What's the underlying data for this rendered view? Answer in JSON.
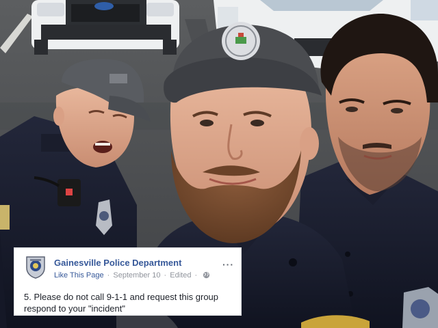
{
  "post": {
    "page_name": "Gainesville Police Department",
    "like_label": "Like This Page",
    "separator": "·",
    "date": "September 10",
    "edited_label": "Edited",
    "more_label": "···",
    "body_text": "5. Please do not call 9-1-1 and request this group respond to your \"incident\""
  },
  "icons": {
    "avatar": "police-badge-icon",
    "audience": "globe-icon",
    "menu": "more-options-icon"
  },
  "colors": {
    "link_blue": "#365899",
    "meta_gray": "#90949c",
    "card_bg": "#ffffff",
    "text": "#1d2129"
  }
}
